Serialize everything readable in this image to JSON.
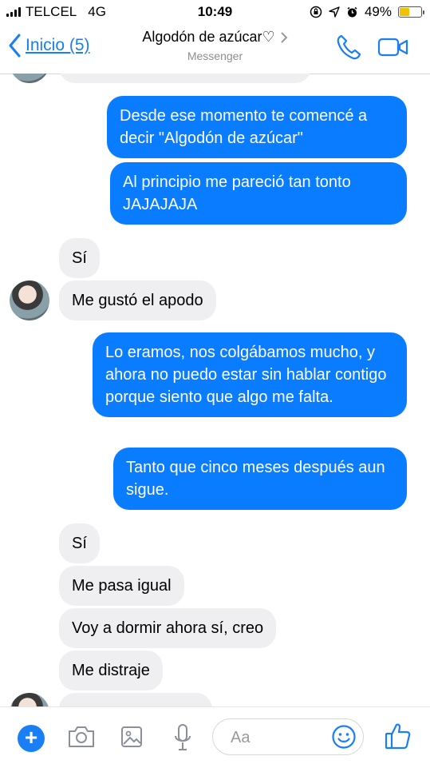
{
  "status_bar": {
    "carrier": "TELCEL",
    "network": "4G",
    "time": "10:49",
    "battery_percent": "49%",
    "battery_level": 0.49
  },
  "header": {
    "back_label": "Inicio (5)",
    "title": "Algodón de azúcar♡",
    "subtitle": "Messenger"
  },
  "messages": [
    {
      "side": "out",
      "text": "Desde ese momento te comencé a decir \"Algodón  de azúcar\""
    },
    {
      "side": "out",
      "text": "Al principio me pareció tan tonto JAJAJAJA"
    },
    {
      "side": "in",
      "text": "Sí"
    },
    {
      "side": "in",
      "text": "Me gustó el apodo"
    },
    {
      "side": "out",
      "text": "Lo eramos, nos colgábamos mucho, y ahora no puedo estar sin hablar contigo porque siento que algo me falta."
    },
    {
      "side": "out",
      "text": "Tanto que cinco meses después aun sigue."
    },
    {
      "side": "in",
      "text": "Sí"
    },
    {
      "side": "in",
      "text": "Me pasa igual"
    },
    {
      "side": "in",
      "text": "Voy a dormir ahora sí, creo"
    },
    {
      "side": "in",
      "text": "Me distraje"
    }
  ],
  "composer": {
    "placeholder": "Aa"
  },
  "colors": {
    "accent": "#1a7ef5",
    "outgoing_bubble": "#0a7cff",
    "incoming_bubble": "#efeff1"
  },
  "icons": [
    "chevron-left-icon",
    "chevron-right-icon",
    "phone-icon",
    "video-icon",
    "plus-icon",
    "camera-icon",
    "image-icon",
    "microphone-icon",
    "emoji-icon",
    "thumbs-up-icon"
  ]
}
